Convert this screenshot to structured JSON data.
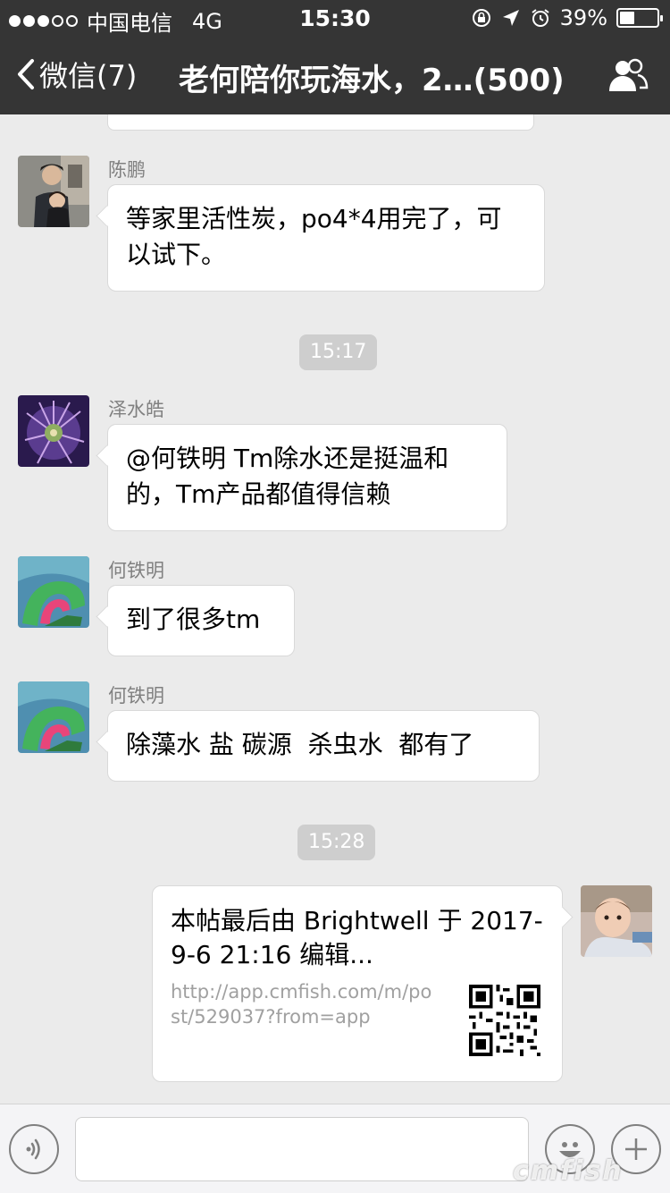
{
  "status_bar": {
    "carrier": "中国电信",
    "network": "4G",
    "time": "15:30",
    "battery_percent": "39%",
    "battery_level": 0.39,
    "signal_bars": 3
  },
  "nav": {
    "back_label": "微信(7)",
    "title": "老何陪你玩海水，2…(500)"
  },
  "messages": [
    {
      "sender": "陈鹏",
      "text": "等家里活性炭，po4*4用完了，可以试下。"
    },
    {
      "sender": "泽水皓",
      "text": "@何铁明 Tm除水还是挺温和的，Tm产品都值得信赖"
    },
    {
      "sender": "何铁明",
      "text": "到了很多tm"
    },
    {
      "sender": "何铁明",
      "text": "除藻水 盐 碳源  杀虫水  都有了"
    }
  ],
  "timestamps": [
    "15:17",
    "15:28"
  ],
  "link_card": {
    "title": "本帖最后由 Brightwell 于 2017-9-6 21:16 编辑...",
    "url": "http://app.cmfish.com/m/post/529037?from=app"
  },
  "watermark": "cmfish",
  "colors": {
    "header_bg": "#353535",
    "chat_bg": "#ebebeb",
    "timestamp_bg": "#cecece"
  },
  "icons": {
    "back": "chevron-left-icon",
    "group": "group-members-icon",
    "voice": "voice-icon",
    "emoji": "emoji-icon",
    "more": "plus-icon"
  }
}
